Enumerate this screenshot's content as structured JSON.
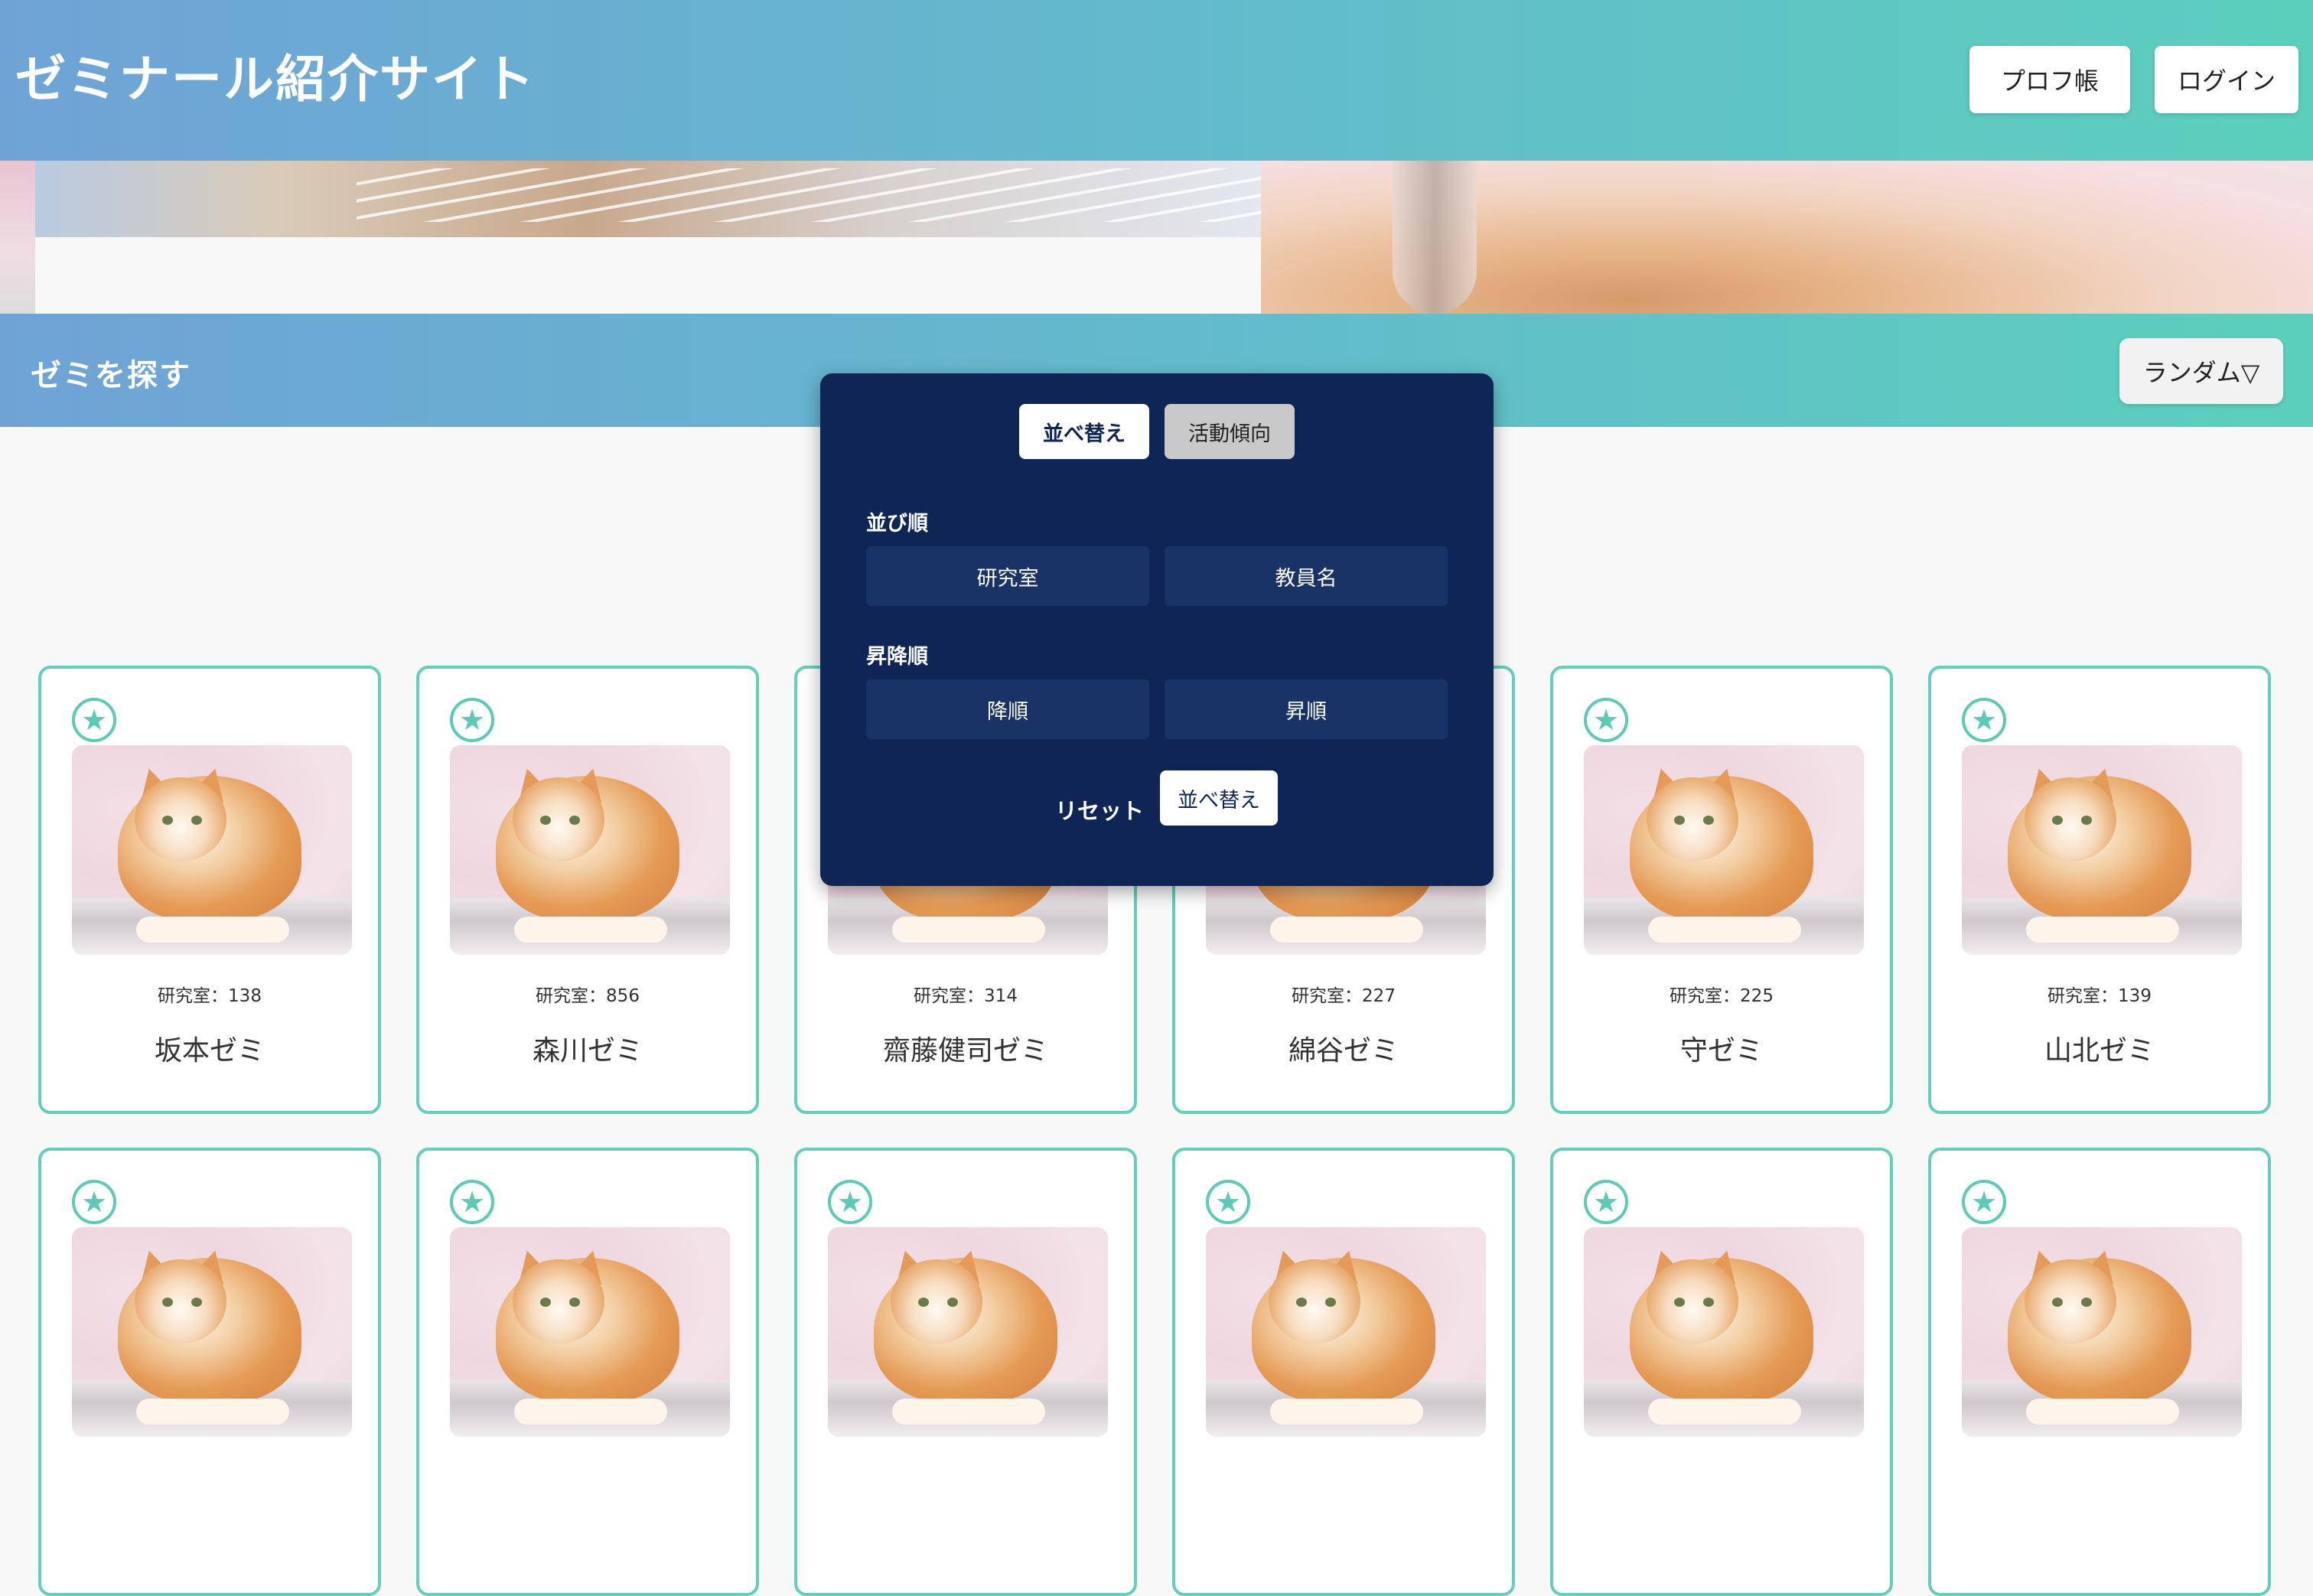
{
  "header": {
    "title": "ゼミナール紹介サイト",
    "profile_button": "プロフ帳",
    "login_button": "ログイン"
  },
  "section": {
    "title": "ゼミを探す",
    "sort_button": "ランダム▽"
  },
  "popover": {
    "tabs": [
      "並べ替え",
      "活動傾向"
    ],
    "order_label": "並び順",
    "order_options": [
      "研究室",
      "教員名"
    ],
    "direction_label": "昇降順",
    "direction_options": [
      "降順",
      "昇順"
    ],
    "reset_label": "リセット",
    "apply_label": "並べ替え"
  },
  "seminars": [
    {
      "room": "研究室：138",
      "name": "坂本ゼミ"
    },
    {
      "room": "研究室：856",
      "name": "森川ゼミ"
    },
    {
      "room": "研究室：314",
      "name": "齋藤健司ゼミ"
    },
    {
      "room": "研究室：227",
      "name": "綿谷ゼミ"
    },
    {
      "room": "研究室：225",
      "name": "守ゼミ"
    },
    {
      "room": "研究室：139",
      "name": "山北ゼミ"
    }
  ],
  "colors": {
    "header_gradient_start": "#6fa3d6",
    "header_gradient_end": "#5ccfbc",
    "card_border": "#62cfbb",
    "popover_bg": "#0e2555"
  }
}
